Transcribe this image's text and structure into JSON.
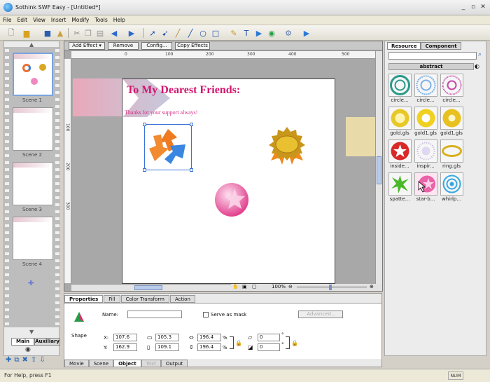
{
  "window": {
    "title": "Sothink SWF Easy - [Untitled*]"
  },
  "menu": [
    "File",
    "Edit",
    "View",
    "Insert",
    "Modify",
    "Tools",
    "Help"
  ],
  "effectbar": {
    "add": "Add Effect",
    "remove": "Remove",
    "config": "Config...",
    "copy": "Copy Effects"
  },
  "ruler": {
    "h": [
      "0",
      "100",
      "200",
      "300",
      "400",
      "500"
    ],
    "v": [
      "100",
      "200",
      "300"
    ]
  },
  "stage": {
    "title": "To My Dearest Friends:",
    "subtitle": "Thanks for your support always!"
  },
  "scenes": [
    "Scene 1",
    "Scene 2",
    "Scene 3",
    "Scene 4"
  ],
  "left_tabs": [
    "Main",
    "Auxiliary"
  ],
  "resource": {
    "tabs": [
      "Resource",
      "Component"
    ],
    "search_placeholder": "",
    "category": "abstract",
    "items": [
      "circle...",
      "circle...",
      "circle...",
      "gold.gls",
      "gold1.gls",
      "gold1.gls",
      "inside...",
      "inspir...",
      "ring.gls",
      "spatte...",
      "star-b...",
      "whirlp..."
    ]
  },
  "zoom": "100%",
  "props": {
    "tabs": [
      "Properties",
      "Fill",
      "Color Transform",
      "Action"
    ],
    "name_label": "Name:",
    "name_value": "",
    "mask_label": "Serve as mask",
    "advanced": "Advanced...",
    "type": "Shape",
    "x_label": "X:",
    "y_label": "Y:",
    "x": "107.6",
    "y": "162.9",
    "w": "105.3",
    "h": "109.1",
    "sx": "196.4",
    "sy": "196.4",
    "pct": "%",
    "skew1": "0",
    "skew2": "0",
    "deg": "°"
  },
  "bottom_tabs": [
    "Movie",
    "Scene",
    "Object",
    "Text",
    "Output"
  ],
  "status": {
    "text": "For Help, press F1",
    "num": "NUM"
  },
  "colors": {
    "title": "#d4146e",
    "selection": "#3a72d6"
  }
}
